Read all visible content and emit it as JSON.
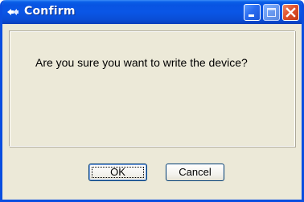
{
  "window": {
    "title": "Confirm",
    "title_icon": "app-icon",
    "caption_buttons": [
      "minimize-icon",
      "maximize-icon",
      "close-icon"
    ],
    "colors": {
      "titlebar": "#0a56e6",
      "frame": "#0a4ee0",
      "body": "#ece9d8",
      "close_button": "#e0502a"
    }
  },
  "dialog": {
    "message": "Are you sure you want to write the device?",
    "ok_label": "OK",
    "cancel_label": "Cancel"
  }
}
